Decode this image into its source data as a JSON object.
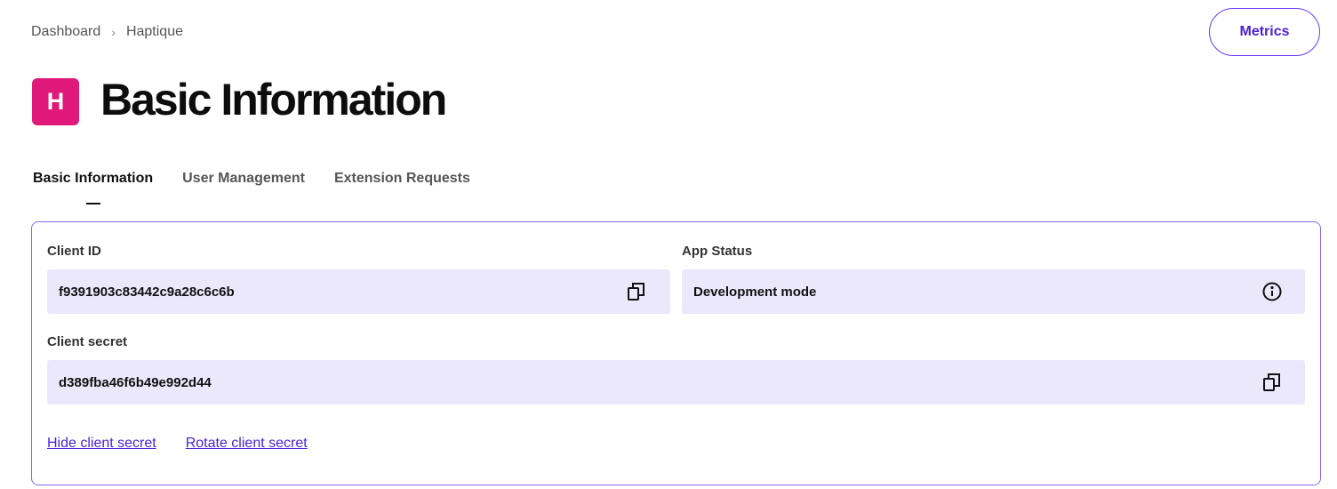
{
  "breadcrumb": {
    "items": [
      "Dashboard",
      "Haptique"
    ],
    "separator": "›"
  },
  "header": {
    "metrics_label": "Metrics",
    "app_logo_letter": "H",
    "title": "Basic Information"
  },
  "tabs": [
    {
      "label": "Basic Information",
      "active": true
    },
    {
      "label": "User Management",
      "active": false
    },
    {
      "label": "Extension Requests",
      "active": false
    }
  ],
  "card": {
    "client_id": {
      "label": "Client ID",
      "value": "f9391903c83442c9a28c6c6b",
      "icon": "copy-icon"
    },
    "app_status": {
      "label": "App Status",
      "value": "Development mode",
      "icon": "info-icon"
    },
    "client_secret": {
      "label": "Client secret",
      "value": "d389fba46f6b49e992d44",
      "icon": "copy-icon"
    },
    "links": {
      "hide_secret": "Hide client secret",
      "rotate_secret": "Rotate client secret"
    }
  },
  "colors": {
    "accent": "#4a1fd6",
    "border": "#8a66f0",
    "field_bg": "#ece8fc",
    "logo_bg": "#e0187a"
  }
}
